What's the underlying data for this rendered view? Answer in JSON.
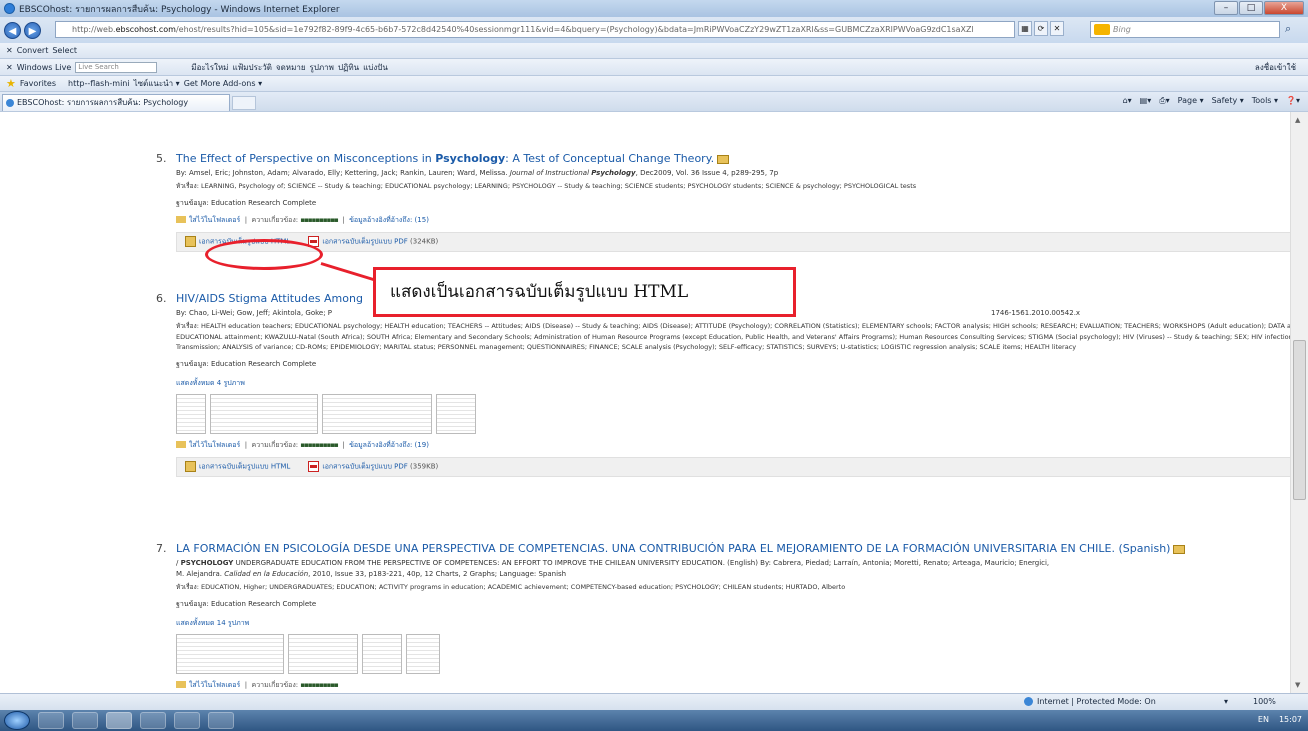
{
  "window": {
    "title": "EBSCOhost: รายการผลการสืบค้น: Psychology - Windows Internet Explorer",
    "buttons": {
      "min": "–",
      "max": "□",
      "close": "X"
    }
  },
  "address": {
    "url_prefix": "http://web.",
    "url_host": "ebscohost.com",
    "url_rest": "/ehost/results?hid=105&sid=1e792f82-89f9-4c65-b6b7-572c8d42540%40sessionmgr111&vid=4&bquery=(Psychology)&bdata=JmRiPWVoaCZzY29wZT1zaXRl&ss=GUBMCZzaXRlPWVoaG9zdC1saXZl",
    "search_placeholder": "Bing",
    "go_icon": "search-icon"
  },
  "toolbar1": {
    "convert": "Convert",
    "select": "Select"
  },
  "toolbar2": {
    "windows_live": "Windows Live",
    "live_search_placeholder": "Live Search",
    "items": [
      "มีอะไรใหม่",
      "แฟ้มประวัติ",
      "จดหมาย",
      "รูปภาพ",
      "ปฏิทิน",
      "แบ่งปัน"
    ],
    "signin": "ลงชื่อเข้าใช้"
  },
  "favbar": {
    "favorites": "Favorites",
    "items": [
      "http--flash-mini",
      "ไซต์แนะนำ ▾",
      "Get More Add-ons ▾"
    ]
  },
  "tab": {
    "label": "EBSCOhost: รายการผลการสืบค้น: Psychology"
  },
  "cmdbar": {
    "page": "Page ▾",
    "safety": "Safety ▾",
    "tools": "Tools ▾",
    "help": "❓▾"
  },
  "results": [
    {
      "num": "5.",
      "title_a": "The Effect of Perspective on Misconceptions in ",
      "title_b": "Psychology",
      "title_c": ": A Test of Conceptual Change Theory.",
      "authors": "By: Amsel, Eric; Johnston, Adam; Alvarado, Elly; Kettering, Jack; Rankin, Lauren; Ward, Melissa.",
      "journal_a": "Journal of Instructional ",
      "journal_b": "Psychology",
      "citation": ", Dec2009, Vol. 36 Issue 4, p289-295, 7p",
      "subjects": "หัวเรื่อง: LEARNING, Psychology of; SCIENCE -- Study & teaching; EDUCATIONAL psychology; LEARNING; PSYCHOLOGY -- Study & teaching; SCIENCE students; PSYCHOLOGY students; SCIENCE & psychology; PSYCHOLOGICAL tests",
      "db": "ฐานข้อมูล: Education Research Complete",
      "folder": "ใส่ไว้ในโฟลเดอร์",
      "relevance": "ความเกี่ยวข้อง:",
      "cited": "ข้อมูลอ้างอิงที่อ้างถึง: (15)",
      "html": "เอกสารฉบับเต็มรูปแบบ HTML",
      "pdf": "เอกสารฉบับเต็มรูปแบบ PDF",
      "pdf_size": "(324KB)"
    },
    {
      "num": "6.",
      "title_a": "HIV/AIDS Stigma Attitudes Among",
      "authors": "By: Chao, Li-Wei; Gow, Jeff; Akintola, Goke; P",
      "doi": "1746-1561.2010.00542.x",
      "subjects": "หัวเรื่อง: HEALTH education teachers; EDUCATIONAL psychology; HEALTH education; TEACHERS -- Attitudes; AIDS (Disease) -- Study & teaching; AIDS (Disease); ATTITUDE (Psychology); CORRELATION (Statistics); ELEMENTARY schools; FACTOR analysis; HIGH schools; RESEARCH; EVALUATION; TEACHERS; WORKSHOPS (Adult education); DATA analysis; EDUCATIONAL attainment; KWAZULU-Natal (South Africa); SOUTH Africa; Elementary and Secondary Schools; Administration of Human Resource Programs (except Education, Public Health, and Veterans' Affairs Programs); Human Resources Consulting Services; STIGMA (Social psychology); HIV (Viruses) -- Study & teaching; SEX; HIV infections -- Transmission; ANALYSIS of variance; CD-ROMs; EPIDEMIOLOGY; MARITAL status; PERSONNEL management; QUESTIONNAIRES; FINANCE; SCALE analysis (Psychology); SELF-efficacy; STATISTICS; SURVEYS; U-statistics; LOGISTIC regression analysis; SCALE items; HEALTH literacy",
      "db": "ฐานข้อมูล: Education Research Complete",
      "images": "แสดงทั้งหมด 4 รูปภาพ",
      "folder": "ใส่ไว้ในโฟลเดอร์",
      "relevance": "ความเกี่ยวข้อง:",
      "cited": "ข้อมูลอ้างอิงที่อ้างถึง: (19)",
      "html": "เอกสารฉบับเต็มรูปแบบ HTML",
      "pdf": "เอกสารฉบับเต็มรูปแบบ PDF",
      "pdf_size": "(359KB)"
    },
    {
      "num": "7.",
      "title_a": "LA FORMACIÓN EN PSICOLOGÍA DESDE UNA PERSPECTIVA DE COMPETENCIAS. UNA CONTRIBUCIÓN PARA EL MEJORAMIENTO DE LA FORMACIÓN UNIVERSITARIA EN CHILE. (Spanish)",
      "alt_a": "/ ",
      "alt_b": "PSYCHOLOGY",
      "alt_c": " UNDERGRADUATE EDUCATION FROM THE PERSPECTIVE OF COMPETENCES: AN EFFORT TO IMPROVE THE CHILEAN UNIVERSITY EDUCATION. (English) By: Cabrera, Piedad; Larraín, Antonia; Moretti, Renato; Arteaga, Mauricio; Energici,",
      "alt_d": "M. Alejandra.",
      "journal_a": "Calidad en la Educación",
      "citation": ", 2010, Issue 33, p183-221, 40p, 12 Charts, 2 Graphs; Language: Spanish",
      "subjects": "หัวเรื่อง: EDUCATION, Higher; UNDERGRADUATES; EDUCATION; ACTIVITY programs in education; ACADEMIC achievement; COMPETENCY-based education; PSYCHOLOGY; CHILEAN students; HURTADO, Alberto",
      "db": "ฐานข้อมูล: Education Research Complete",
      "images": "แสดงทั้งหมด 14 รูปภาพ",
      "folder": "ใส่ไว้ในโฟลเดอร์",
      "relevance": "ความเกี่ยวข้อง:"
    }
  ],
  "annotation": {
    "text": "แสดงเป็นเอกสารฉบับเต็มรูปแบบ HTML"
  },
  "status": {
    "zone": "Internet | Protected Mode: On",
    "zoom": "100%",
    "zoom_icon": "▾"
  },
  "taskbar": {
    "time": "15:07",
    "lang": "EN"
  }
}
